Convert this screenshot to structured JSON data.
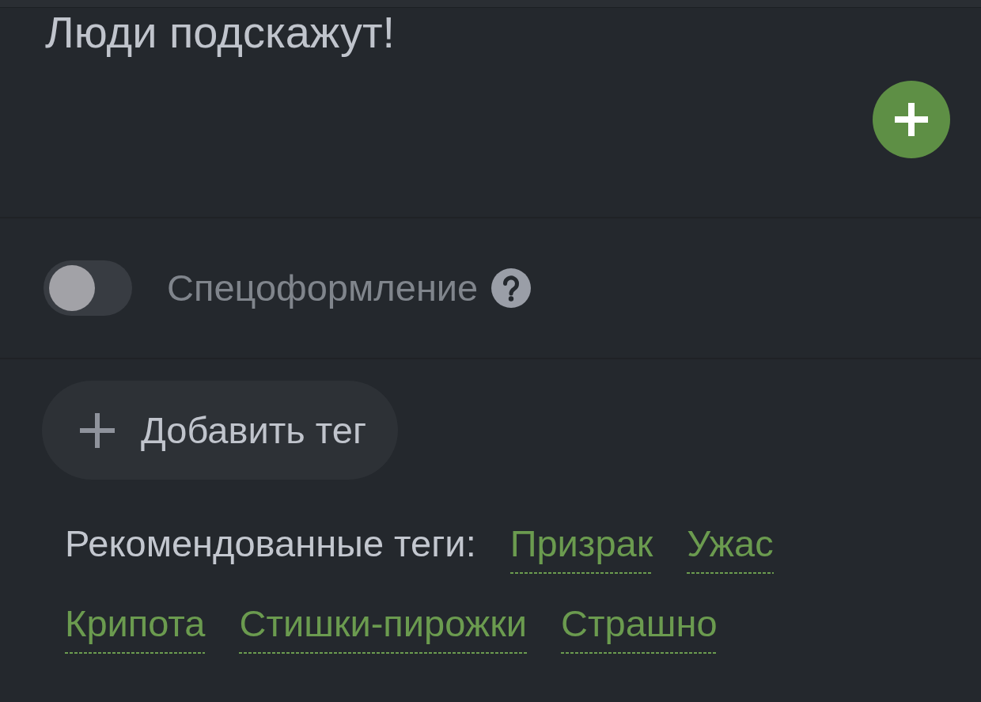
{
  "question": {
    "title": "Люди подскажут!"
  },
  "special_design": {
    "label": "Спецоформление",
    "on": false
  },
  "add_tag_button": {
    "label": "Добавить тег"
  },
  "recommended_tags": {
    "label": "Рекомендованные теги:",
    "tags": [
      {
        "label": "Призрак"
      },
      {
        "label": "Ужас"
      },
      {
        "label": "Крипота"
      },
      {
        "label": "Стишки-пирожки"
      },
      {
        "label": "Страшно"
      }
    ]
  }
}
